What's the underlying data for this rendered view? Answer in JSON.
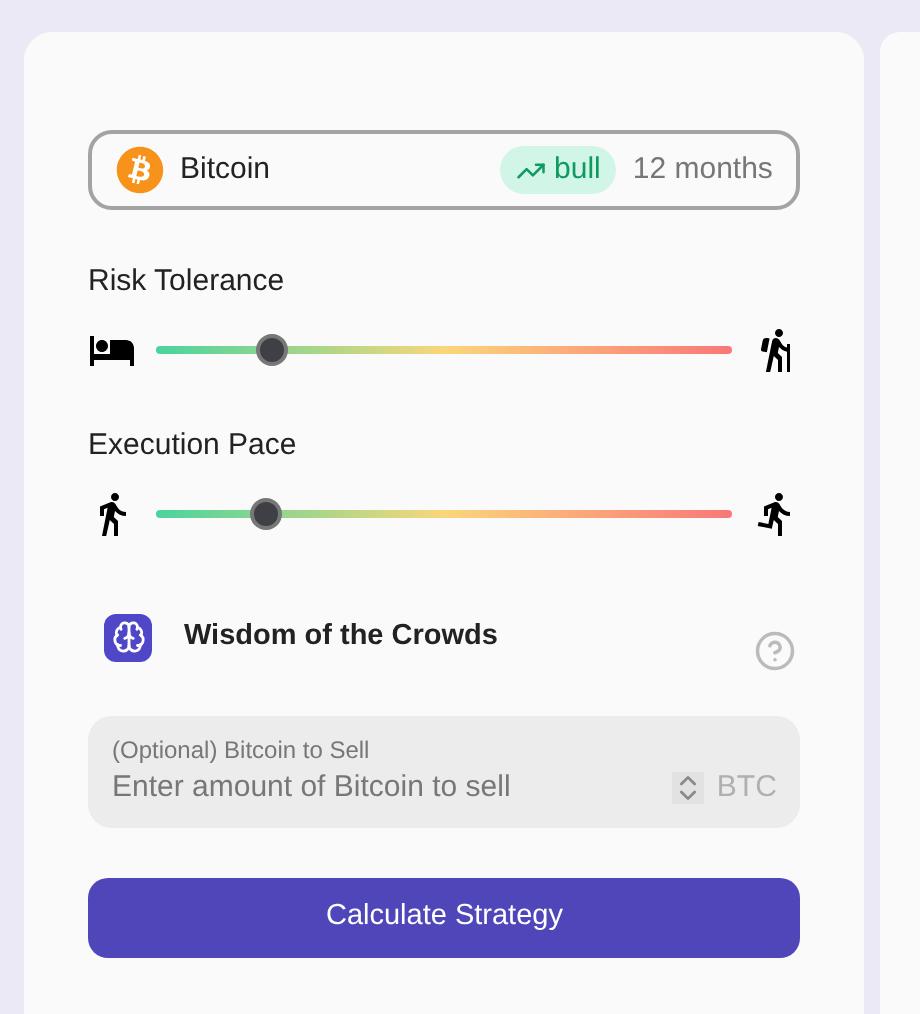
{
  "asset": {
    "name": "Bitcoin",
    "trend": "bull",
    "horizon": "12 months"
  },
  "sliders": [
    {
      "label": "Risk Tolerance",
      "level": 0.2,
      "kind": "risk"
    },
    {
      "label": "Execution Pace",
      "level": 0.19,
      "kind": "pace"
    }
  ],
  "feature": {
    "label": "Wisdom of the Crowds"
  },
  "sell_field": {
    "label": "(Optional) Bitcoin to Sell",
    "placeholder": "Enter amount of Bitcoin to sell",
    "unit": "BTC"
  },
  "submit": {
    "label": "Calculate Strategy"
  }
}
